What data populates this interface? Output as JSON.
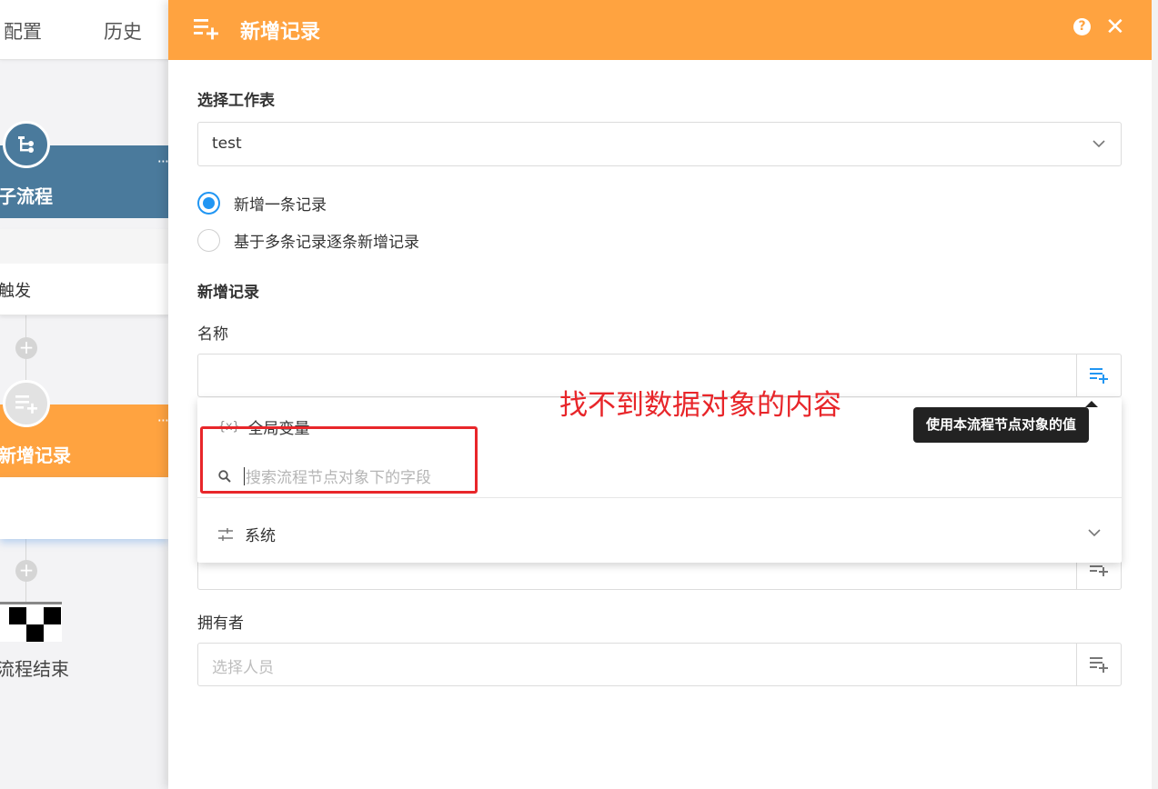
{
  "left_canvas": {
    "tabs": {
      "config": "配置",
      "history": "历史"
    },
    "subprocess_node": {
      "title": "子流程",
      "more": "···",
      "trigger_text": "触发"
    },
    "add_record_node": {
      "title": "新增记录",
      "more": "···"
    },
    "end_text": "流程结束"
  },
  "panel": {
    "title": "新增记录",
    "help": "?",
    "close": "✕",
    "select_sheet_label": "选择工作表",
    "sheet_value": "test",
    "radio_options": [
      "新增一条记录",
      "基于多条记录逐条新增记录"
    ],
    "radio_selected": 0,
    "section_title": "新增记录",
    "name_label": "名称",
    "owner_label": "拥有者",
    "owner_placeholder": "选择人员"
  },
  "dropdown": {
    "global_var_icon": "{x}",
    "global_var_label": "全局变量",
    "search_placeholder": "搜索流程节点对象下的字段",
    "system_label": "系统"
  },
  "tooltip": "使用本流程节点对象的值",
  "annotation": "找不到数据对象的内容",
  "colors": {
    "header_orange": "#ffa340",
    "node_blue": "#4a7a9c",
    "radio_blue": "#2196f3",
    "annotation_red": "#e8262a"
  }
}
